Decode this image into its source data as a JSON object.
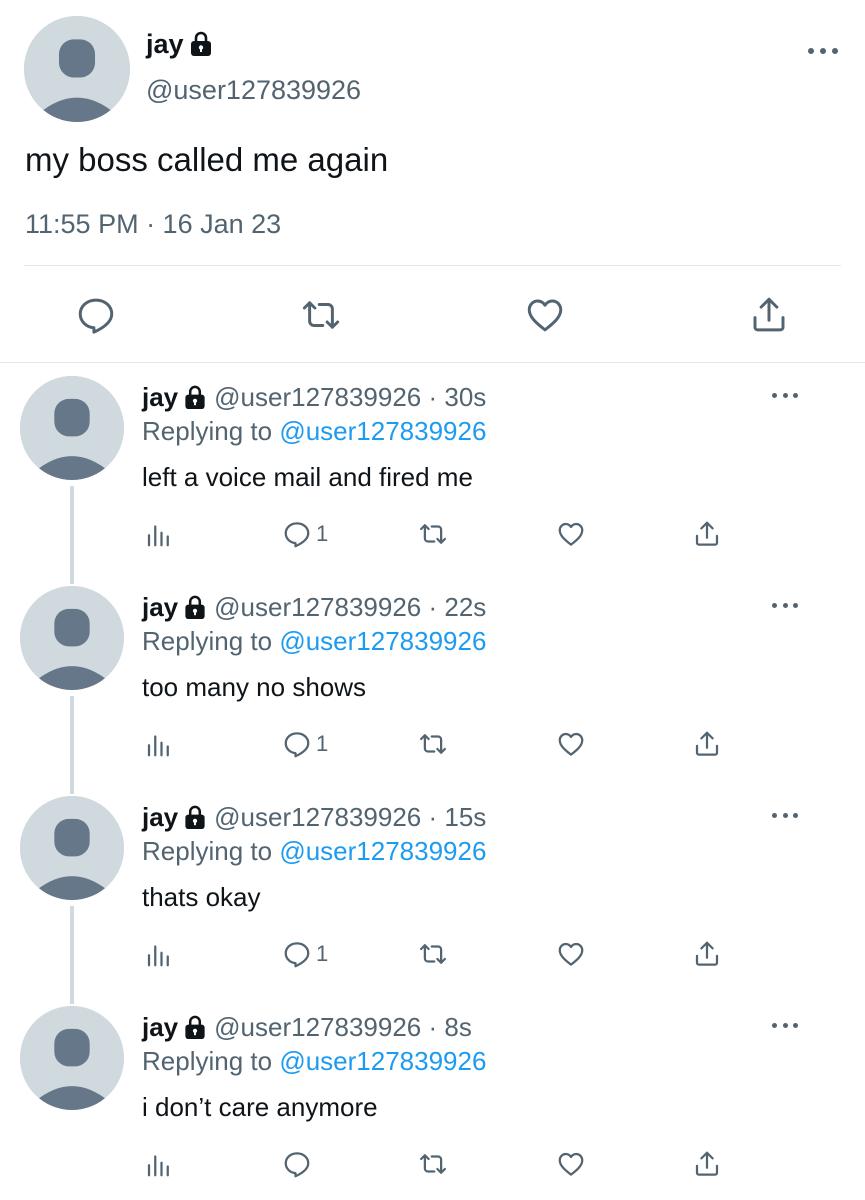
{
  "main_tweet": {
    "display_name": "jay",
    "handle": "@user127839926",
    "text": "my boss called me again",
    "timestamp": "11:55 PM · 16 Jan 23",
    "icons": [
      "reply-icon",
      "retweet-icon",
      "like-icon",
      "share-icon"
    ]
  },
  "replies": [
    {
      "display_name": "jay",
      "handle_time": "@user127839926 · 30s",
      "replying_prefix": "Replying to ",
      "replying_to": "@user127839926",
      "text": "left a voice mail and fired me",
      "reply_count": "1"
    },
    {
      "display_name": "jay",
      "handle_time": "@user127839926 · 22s",
      "replying_prefix": "Replying to ",
      "replying_to": "@user127839926",
      "text": "too many no shows",
      "reply_count": "1"
    },
    {
      "display_name": "jay",
      "handle_time": "@user127839926 · 15s",
      "replying_prefix": "Replying to ",
      "replying_to": "@user127839926",
      "text": "thats okay",
      "reply_count": "1"
    },
    {
      "display_name": "jay",
      "handle_time": "@user127839926 · 8s",
      "replying_prefix": "Replying to ",
      "replying_to": "@user127839926",
      "text": "i don’t care anymore",
      "reply_count": ""
    }
  ],
  "colors": {
    "text": "#0f1419",
    "secondary": "#536471",
    "link": "#1d9bf0",
    "avatar_bg": "#cfd9de",
    "avatar_fg": "#66778a",
    "divider": "#e1e6ea"
  }
}
